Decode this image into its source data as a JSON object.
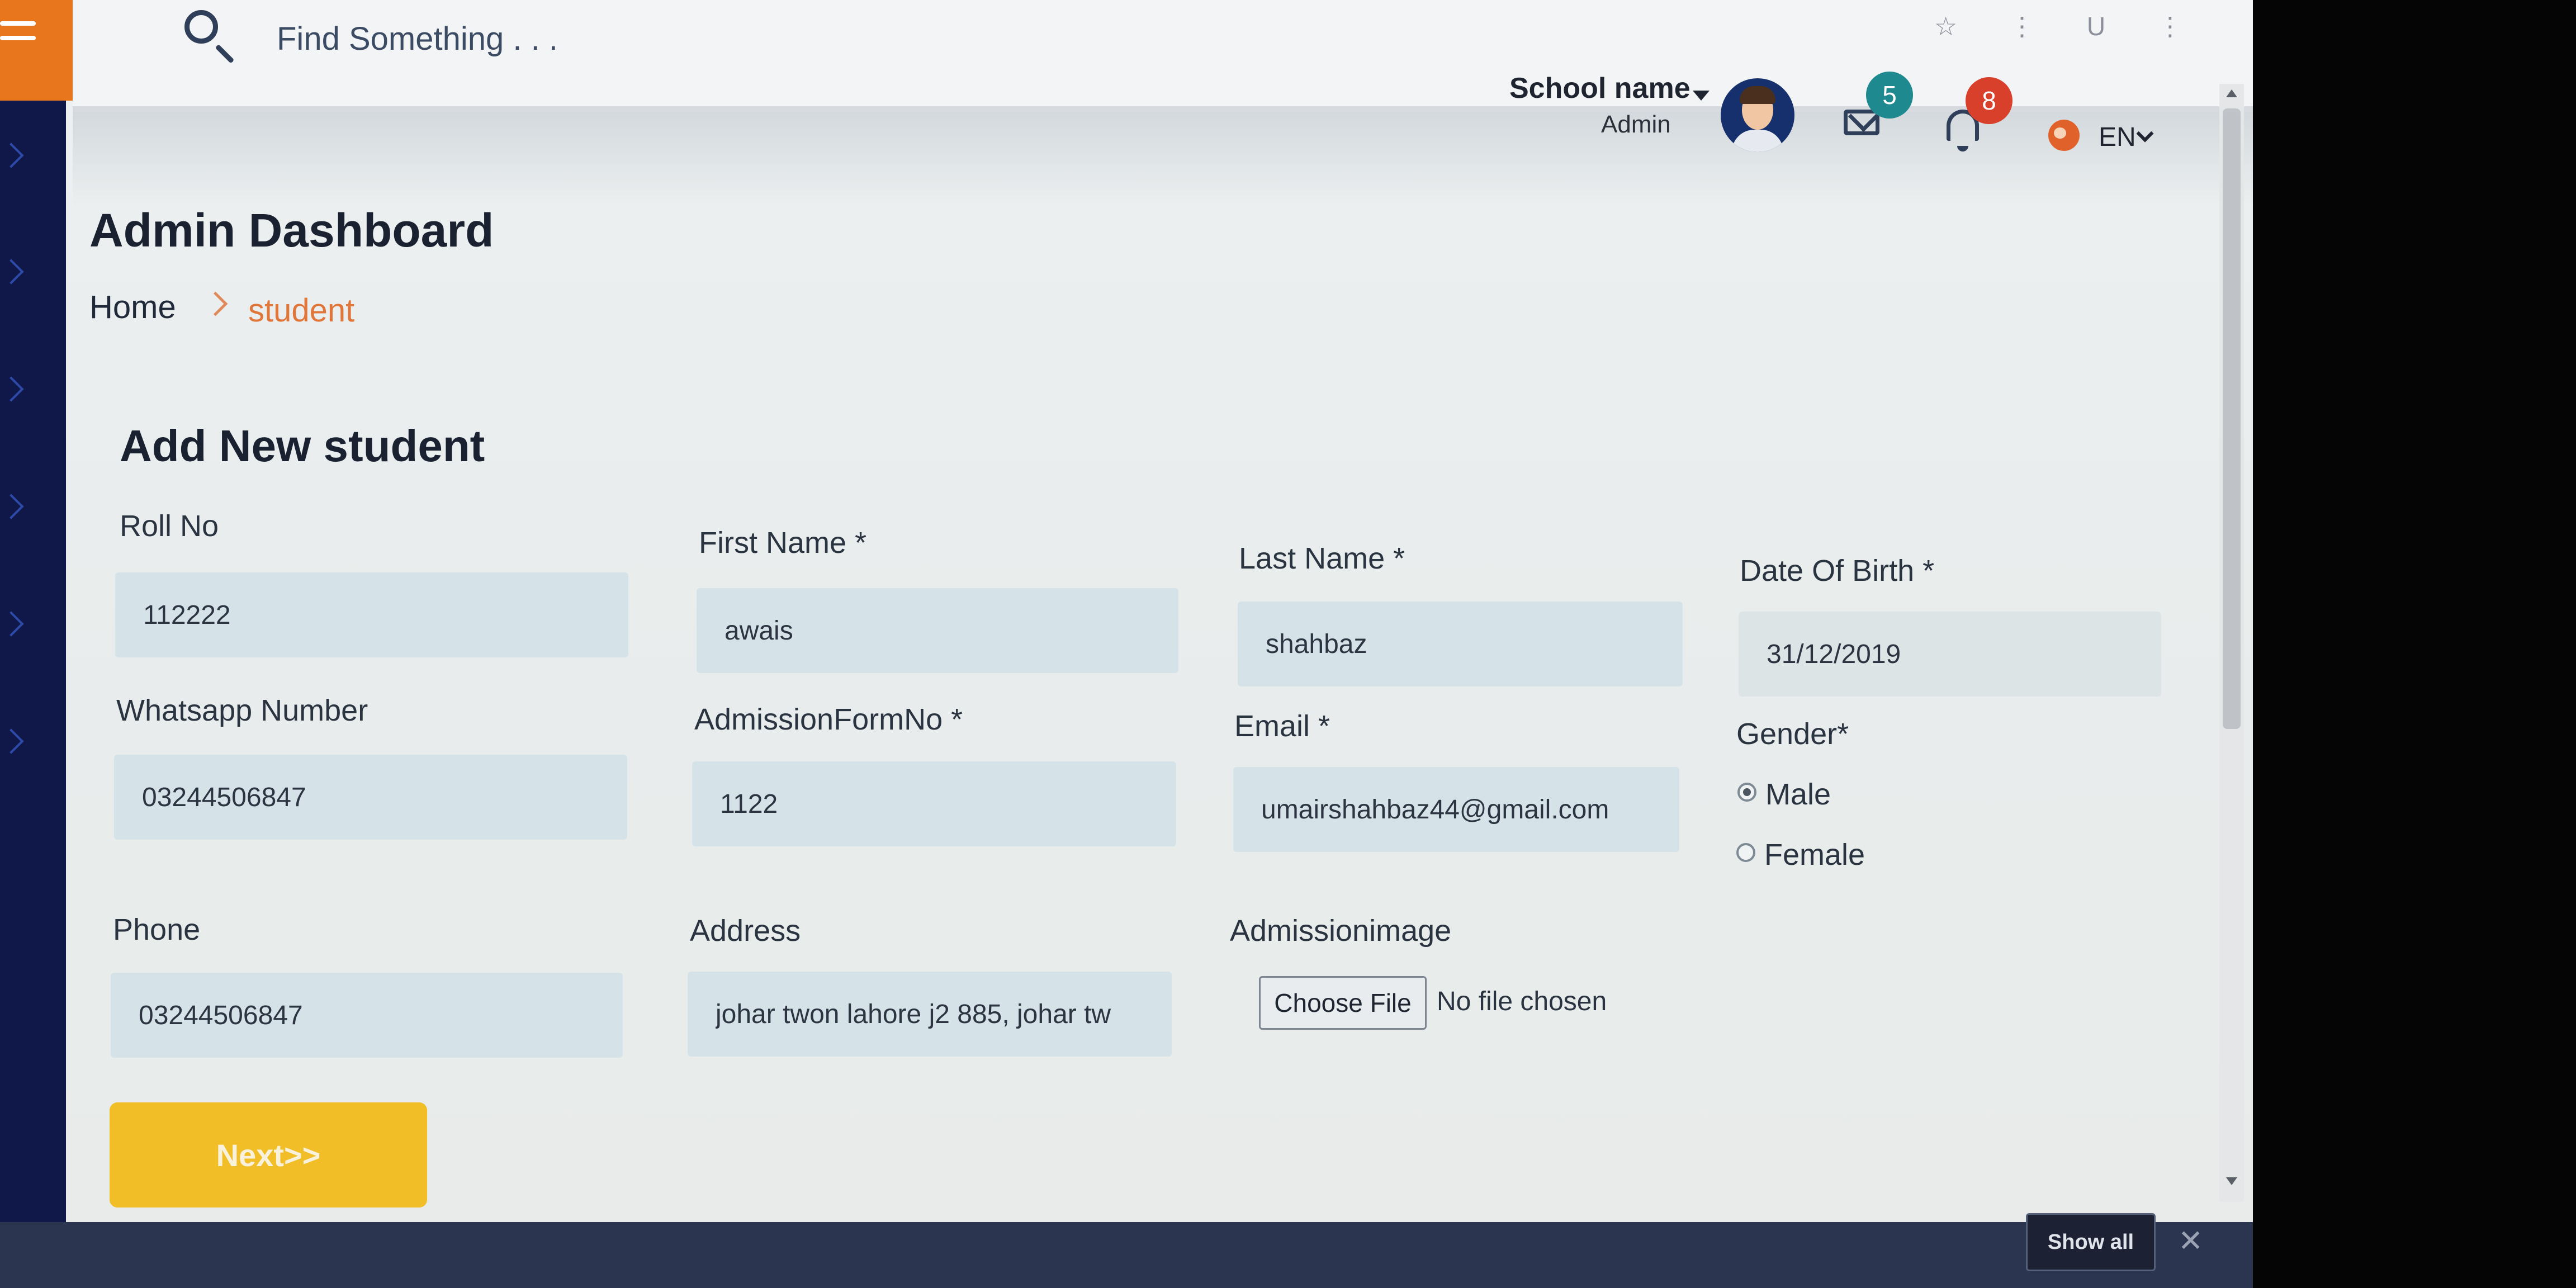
{
  "topbar": {
    "search_placeholder": "Find Something . . .",
    "school_name": "School name",
    "role": "Admin",
    "mail_count": "5",
    "notification_count": "8",
    "language": "EN"
  },
  "browser": {
    "star": "☆",
    "menu": "⋮",
    "profile": "U"
  },
  "page": {
    "title": "Admin Dashboard",
    "breadcrumb": {
      "home": "Home",
      "current": "student"
    }
  },
  "form": {
    "title": "Add New student",
    "fields": {
      "roll_no": {
        "label": "Roll No",
        "value": "112222"
      },
      "first_name": {
        "label": "First Name *",
        "value": "awais"
      },
      "last_name": {
        "label": "Last Name *",
        "value": "shahbaz"
      },
      "dob": {
        "label": "Date Of Birth *",
        "value": "31/12/2019"
      },
      "whatsapp": {
        "label": "Whatsapp Number",
        "value": "03244506847"
      },
      "admission_form_no": {
        "label": "AdmissionFormNo *",
        "value": "1122"
      },
      "email": {
        "label": "Email *",
        "value": "umairshahbaz44@gmail.com"
      },
      "gender": {
        "label": "Gender*",
        "options": [
          "Male",
          "Female"
        ],
        "selected": "Male"
      },
      "phone": {
        "label": "Phone",
        "value": "03244506847"
      },
      "address": {
        "label": "Address",
        "value": "johar twon lahore j2 885, johar tw"
      },
      "admission_image": {
        "label": "Admissionimage",
        "button": "Choose File",
        "status": "No file chosen"
      }
    },
    "next_label": "Next>>"
  },
  "downloads": {
    "show_all": "Show all",
    "close": "✕"
  },
  "colors": {
    "sidebar": "#10184a",
    "menu_accent": "#e8761c",
    "breadcrumb_active": "#e0763a",
    "input_bg": "#d5e3e9",
    "next_button": "#f2be28",
    "mail_badge": "#1e8a8f",
    "bell_badge": "#d8402c"
  }
}
